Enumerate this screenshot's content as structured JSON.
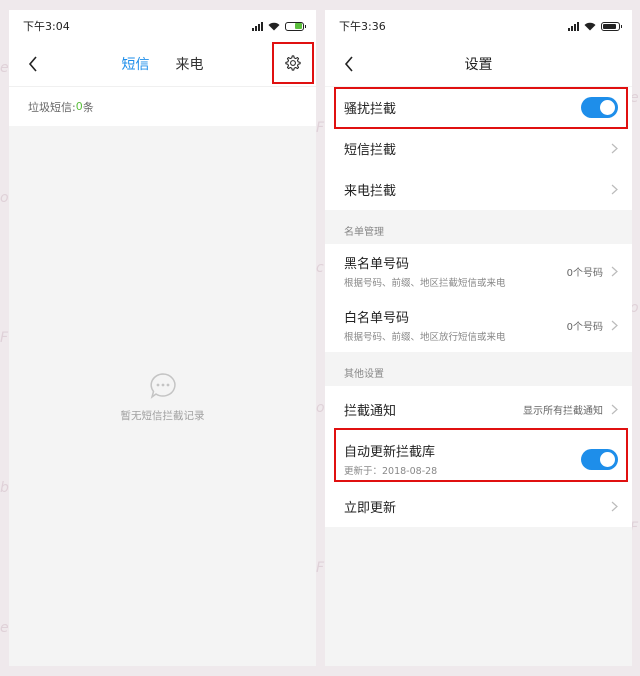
{
  "left_screen": {
    "status_bar": {
      "time": "下午3:04"
    },
    "tabs": [
      {
        "label": "短信",
        "active": true
      },
      {
        "label": "来电",
        "active": false
      }
    ],
    "spam": {
      "label": "垃圾短信:",
      "count": "0",
      "unit": "条"
    },
    "empty_state": {
      "icon": "chat-bubble-icon",
      "text": "暂无短信拦截记录"
    },
    "icons": {
      "back": "back-arrow-icon",
      "settings": "gear-icon"
    }
  },
  "right_screen": {
    "status_bar": {
      "time": "下午3:36"
    },
    "title": "设置",
    "rows": {
      "harassment": {
        "title": "骚扰拦截",
        "toggle_on": true
      },
      "sms": {
        "title": "短信拦截"
      },
      "call": {
        "title": "来电拦截"
      },
      "list_section": "名单管理",
      "blacklist": {
        "title": "黑名单号码",
        "subtitle": "根据号码、前缀、地区拦截短信或来电",
        "value": "0个号码"
      },
      "whitelist": {
        "title": "白名单号码",
        "subtitle": "根据号码、前缀、地区放行短信或来电",
        "value": "0个号码"
      },
      "other_section": "其他设置",
      "notify": {
        "title": "拦截通知",
        "value": "显示所有拦截通知"
      },
      "auto_update": {
        "title": "自动更新拦截库",
        "subtitle": "更新于：2018-08-28",
        "toggle_on": true
      },
      "update_now": {
        "title": "立即更新"
      }
    }
  },
  "colors": {
    "accent": "#1e8eea",
    "highlight": "#e01010",
    "count_green": "#5bbf3c"
  }
}
